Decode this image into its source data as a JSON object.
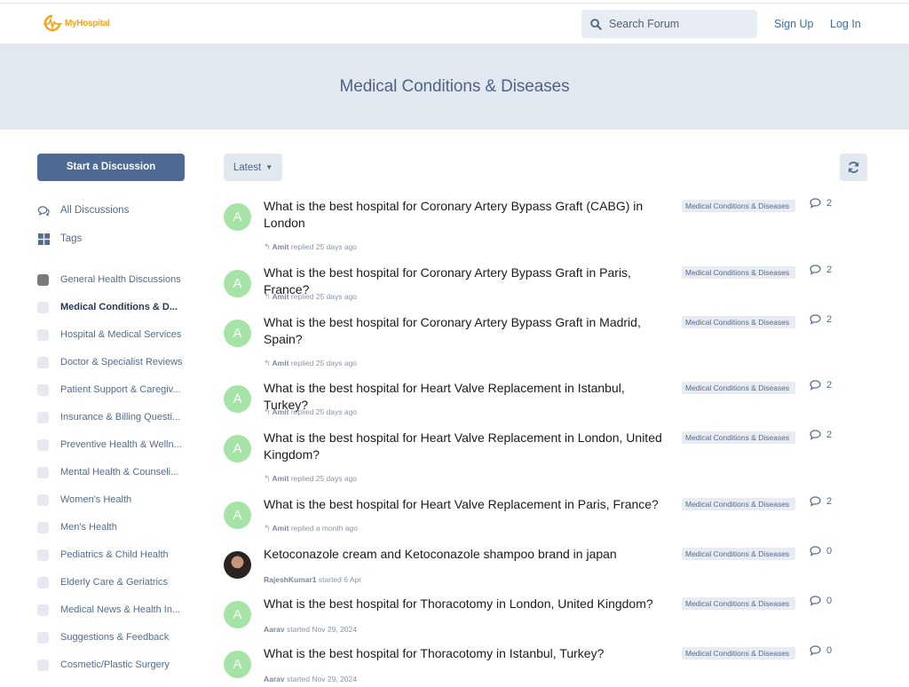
{
  "header": {
    "logo_text": "MyHospital",
    "search_placeholder": "Search Forum",
    "sign_up": "Sign Up",
    "log_in": "Log In"
  },
  "hero": {
    "title": "Medical Conditions & Diseases"
  },
  "sidebar": {
    "start_discussion": "Start a Discussion",
    "nav": [
      {
        "label": "All Discussions",
        "icon": "comments-icon"
      },
      {
        "label": "Tags",
        "icon": "tags-grid-icon"
      }
    ],
    "tags": [
      {
        "label": "General Health Discussions",
        "color": "#7a7a7a"
      },
      {
        "label": "Medical Conditions & D...",
        "active": true
      },
      {
        "label": "Hospital & Medical Services"
      },
      {
        "label": "Doctor & Specialist Reviews"
      },
      {
        "label": "Patient Support & Caregiv..."
      },
      {
        "label": "Insurance & Billing Questi..."
      },
      {
        "label": "Preventive Health & Welln..."
      },
      {
        "label": "Mental Health & Counseli..."
      },
      {
        "label": "Women's Health"
      },
      {
        "label": "Men's Health"
      },
      {
        "label": "Pediatrics & Child Health"
      },
      {
        "label": "Elderly Care & Geriatrics"
      },
      {
        "label": "Medical News & Health In..."
      },
      {
        "label": "Suggestions & Feedback"
      },
      {
        "label": "Cosmetic/Plastic Surgery"
      }
    ]
  },
  "toolbar": {
    "sort_label": "Latest"
  },
  "discussions": [
    {
      "title": "What is the best hospital for Coronary Artery Bypass Graft (CABG) in London",
      "avatar": "A",
      "user": "Amit",
      "action": "replied",
      "time": "25 days ago",
      "tag": "Medical Conditions & Diseases",
      "replies": "2"
    },
    {
      "title": "What is the best hospital for Coronary Artery Bypass Graft in Paris, France?",
      "avatar": "A",
      "user": "Amit",
      "action": "replied",
      "time": "25 days ago",
      "tag": "Medical Conditions & Diseases",
      "replies": "2"
    },
    {
      "title": "What is the best hospital for Coronary Artery Bypass Graft in Madrid, Spain?",
      "avatar": "A",
      "user": "Amit",
      "action": "replied",
      "time": "25 days ago",
      "tag": "Medical Conditions & Diseases",
      "replies": "2"
    },
    {
      "title": "What is the best hospital for Heart Valve Replacement in Istanbul, Turkey?",
      "avatar": "A",
      "user": "Amit",
      "action": "replied",
      "time": "25 days ago",
      "tag": "Medical Conditions & Diseases",
      "replies": "2"
    },
    {
      "title": "What is the best hospital for Heart Valve Replacement in London, United Kingdom?",
      "avatar": "A",
      "user": "Amit",
      "action": "replied",
      "time": "25 days ago",
      "tag": "Medical Conditions & Diseases",
      "replies": "2"
    },
    {
      "title": "What is the best hospital for Heart Valve Replacement in Paris, France?",
      "avatar": "A",
      "user": "Amit",
      "action": "replied",
      "time": "a month ago",
      "tag": "Medical Conditions & Diseases",
      "replies": "2"
    },
    {
      "title": "Ketoconazole cream and Ketoconazole shampoo brand in japan",
      "avatar": "",
      "user": "RajeshKumar1",
      "action": "started",
      "time": "6 Apr",
      "tag": "Medical Conditions & Diseases",
      "replies": "0",
      "photo": true
    },
    {
      "title": "What is the best hospital for Thoracotomy in London, United Kingdom?",
      "avatar": "A",
      "user": "Aarav",
      "action": "started",
      "time": "Nov 29, 2024",
      "tag": "Medical Conditions & Diseases",
      "replies": "0"
    },
    {
      "title": "What is the best hospital for Thoracotomy in Istanbul, Turkey?",
      "avatar": "A",
      "user": "Aarav",
      "action": "started",
      "time": "Nov 29, 2024",
      "tag": "Medical Conditions & Diseases",
      "replies": "0"
    }
  ]
}
